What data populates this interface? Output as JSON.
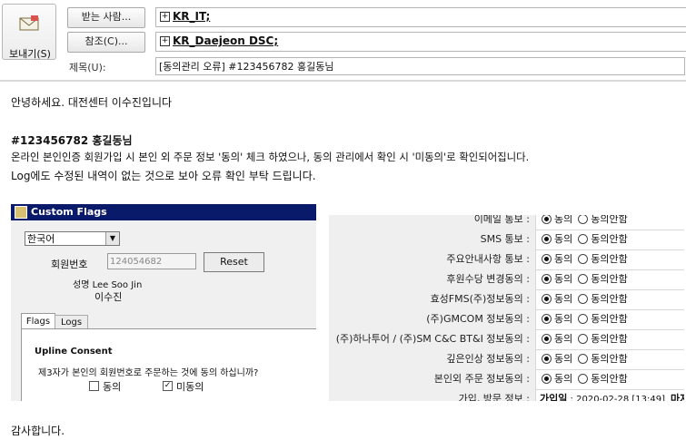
{
  "header": {
    "send_label": "보내기(S)",
    "to_button": "받는 사람...",
    "cc_button": "참조(C)...",
    "subject_label": "제목(U):",
    "to_value": "KR_IT;",
    "cc_value": "KR_Daejeon DSC;",
    "subject_value": "[동의관리 오류] #123456782 홍길동님"
  },
  "body": {
    "greeting": "안녕하세요.  대전센터 이수진입니다",
    "member_heading": "#123456782   홍길동님",
    "line1": "온라인 본인인증 회원가입 시 본인 외 주문 정보 '동의' 체크 하였으나, 동의 관리에서 확인 시 '미동의'로 확인되어집니다.",
    "line2": "Log에도 수정된 내역이 없는 것으로 보아 오류 확인 부탁 드립니다.",
    "closing": "감사합니다."
  },
  "custom_flags": {
    "title": "Custom Flags",
    "language": "한국어",
    "member_no_label": "회원번호",
    "member_no_value": "124054682",
    "reset_label": "Reset",
    "name_label": "성명 Lee Soo Jin",
    "name_ko": "이수진",
    "tabs": [
      "Flags",
      "Logs"
    ],
    "upline_title": "Upline Consent",
    "upline_question": "제3자가 본인의 회원번호로 주문하는 것에 동의 하십니까?",
    "agree_label": "동의",
    "disagree_label": "미동의",
    "agree_checked": false,
    "disagree_checked": true
  },
  "consent_table": {
    "agree": "동의",
    "disagree": "동의안함",
    "rows": [
      {
        "label": "이메일 통보 :",
        "agree": true
      },
      {
        "label": "SMS 통보 :",
        "agree": true
      },
      {
        "label": "주요안내사항 통보 :",
        "agree": true
      },
      {
        "label": "후원수당 변경동의 :",
        "agree": true
      },
      {
        "label": "효성FMS(주)정보동의 :",
        "agree": true
      },
      {
        "label": "(주)GMCOM 정보동의 :",
        "agree": true
      },
      {
        "label": "(주)하나투어 / (주)SM C&C BT&I 정보동의 :",
        "agree": true
      },
      {
        "label": "깊은인상 정보동의 :",
        "agree": true
      },
      {
        "label": "본인외 주문 정보동의 :",
        "agree": true
      }
    ],
    "last_row_label": "가입, 방문 정보 :",
    "last_row_bold": "가입일",
    "last_row_value": " : 2020-02-28 [13:49]",
    "last_row_extra": "마지"
  },
  "colors": {
    "titlebar": "#0a1a6b"
  }
}
